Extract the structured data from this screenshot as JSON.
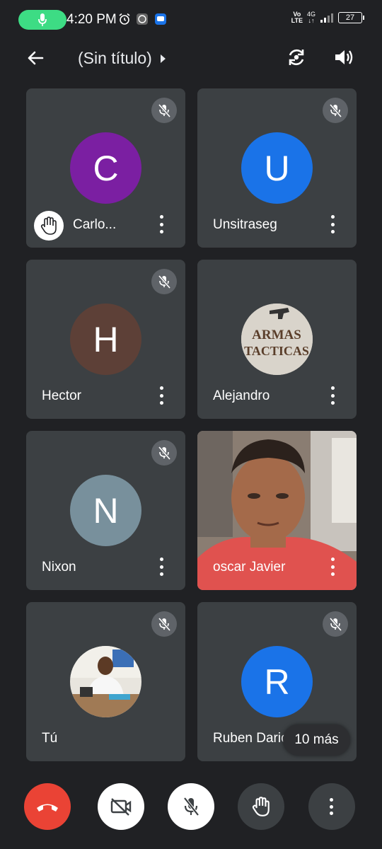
{
  "status_bar": {
    "time": "4:20 PM",
    "volte": "Vo\nLTE",
    "network": "4G",
    "battery": "27"
  },
  "app_bar": {
    "title": "(Sin título)"
  },
  "participants": [
    {
      "name": "Carlo...",
      "initial": "C",
      "avatar_color": "#7b1fa2",
      "muted": true,
      "hand_raised": true
    },
    {
      "name": "Unsitraseg",
      "initial": "U",
      "avatar_color": "#1a73e8",
      "muted": true
    },
    {
      "name": "Hector",
      "initial": "H",
      "avatar_color": "#5d4037",
      "muted": true
    },
    {
      "name": "Alejandro",
      "initial": "",
      "avatar_color": "#d7d2c8",
      "muted": false,
      "photo_text": "ARMAS TACTICAS"
    },
    {
      "name": "Nixon",
      "initial": "N",
      "avatar_color": "#78909c",
      "muted": true
    },
    {
      "name": "oscar Javier",
      "initial": "",
      "video": true,
      "muted": false
    },
    {
      "name": "Tú",
      "initial": "",
      "avatar_color": "#cfd8dc",
      "muted": true,
      "photo": true
    },
    {
      "name": "Ruben Dario",
      "initial": "R",
      "avatar_color": "#1a73e8",
      "muted": true
    }
  ],
  "overflow": {
    "label": "10 más"
  },
  "controls": {
    "end_call_color": "#ea4335"
  }
}
